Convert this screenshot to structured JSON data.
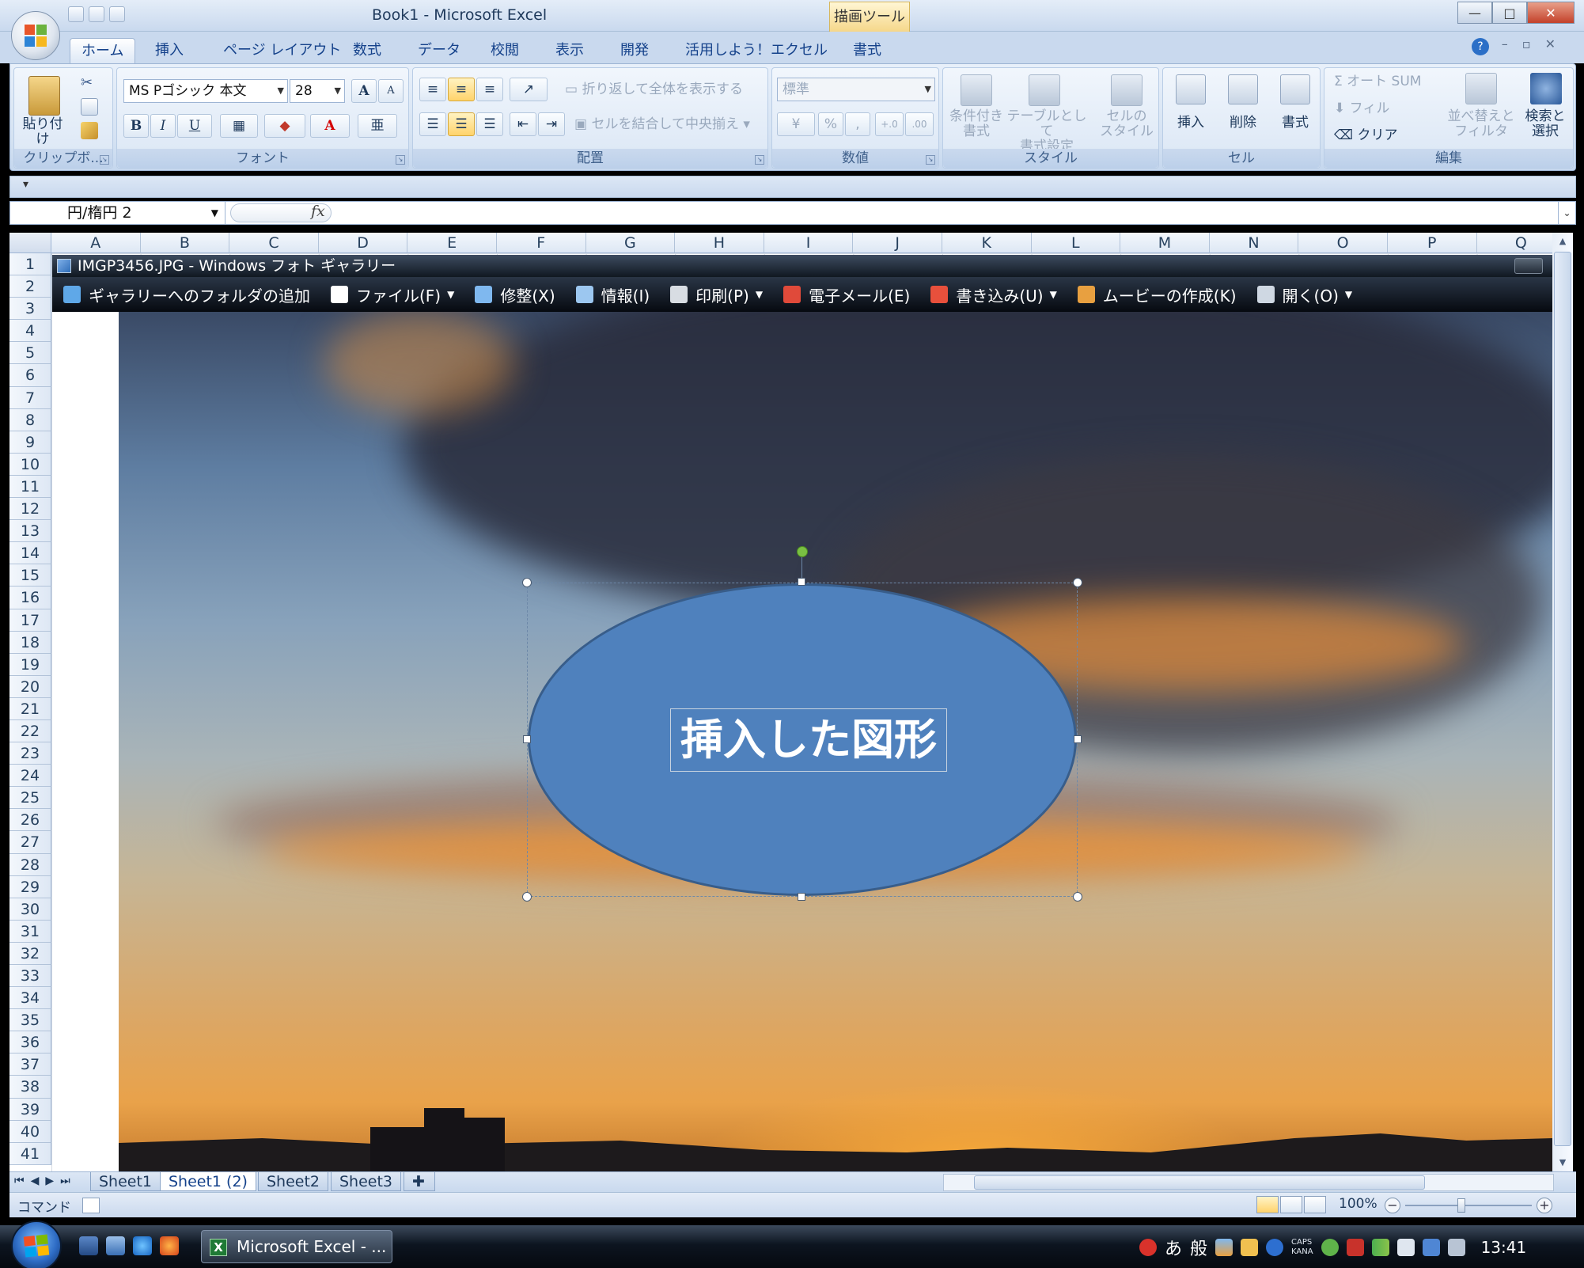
{
  "window": {
    "title": "Book1 - Microsoft Excel",
    "context_tab_title": "描画ツール",
    "controls": {
      "minimize": "—",
      "maximize": "□",
      "close": "✕"
    }
  },
  "ribbon": {
    "tabs": [
      "ホーム",
      "挿入",
      "ページ レイアウト",
      "数式",
      "データ",
      "校閲",
      "表示",
      "開発",
      "活用しよう！エクセル",
      "書式"
    ],
    "active_tab": "ホーム",
    "clipboard": {
      "paste": "貼り付け",
      "group_label": "クリップボ..."
    },
    "font": {
      "font_name": "MS Pゴシック 本文",
      "font_size": "28",
      "bold": "B",
      "italic": "I",
      "underline": "U",
      "grow": "A",
      "shrink": "A",
      "font_color_letter": "A",
      "group_label": "フォント"
    },
    "alignment": {
      "wrap_text": "折り返して全体を表示する",
      "merge_center": "セルを結合して中央揃え",
      "group_label": "配置"
    },
    "number": {
      "format": "標準",
      "percent": "%",
      "comma": ",",
      "inc_decimal": "+.0",
      "dec_decimal": ".00",
      "group_label": "数値"
    },
    "styles": {
      "conditional_l1": "条件付き",
      "conditional_l2": "書式",
      "table_l1": "テーブルとして",
      "table_l2": "書式設定",
      "cell_styles_l1": "セルの",
      "cell_styles_l2": "スタイル",
      "group_label": "スタイル"
    },
    "cells": {
      "insert": "挿入",
      "delete": "削除",
      "format": "書式",
      "group_label": "セル"
    },
    "editing": {
      "autosum": "Σ オート SUM",
      "fill": "フィル",
      "clear": "クリア",
      "sort_l1": "並べ替えと",
      "sort_l2": "フィルタ",
      "find_l1": "検索と",
      "find_l2": "選択",
      "group_label": "編集"
    }
  },
  "formula_bar": {
    "name_box": "円/楕円 2",
    "fx": "fx",
    "formula": ""
  },
  "grid": {
    "columns": [
      "A",
      "B",
      "C",
      "D",
      "E",
      "F",
      "G",
      "H",
      "I",
      "J",
      "K",
      "L",
      "M",
      "N",
      "O",
      "P",
      "Q"
    ],
    "rows": [
      "1",
      "2",
      "3",
      "4",
      "5",
      "6",
      "7",
      "8",
      "9",
      "10",
      "11",
      "12",
      "13",
      "14",
      "15",
      "16",
      "17",
      "18",
      "19",
      "20",
      "21",
      "22",
      "23",
      "24",
      "25",
      "26",
      "27",
      "28",
      "29",
      "30",
      "31",
      "32",
      "33",
      "34",
      "35",
      "36",
      "37",
      "38",
      "39",
      "40",
      "41"
    ]
  },
  "gallery": {
    "title": "IMGP3456.JPG - Windows フォト ギャラリー",
    "toolbar": [
      {
        "label": "ギャラリーへのフォルダの追加",
        "icon": "add-folder-icon",
        "color": "#5fa8e8",
        "dropdown": false
      },
      {
        "label": "ファイル(F)",
        "icon": "file-icon",
        "color": "#ffffff",
        "dropdown": true
      },
      {
        "label": "修整(X)",
        "icon": "fix-icon",
        "color": "#7fb8ef",
        "dropdown": false
      },
      {
        "label": "情報(I)",
        "icon": "info-tag-icon",
        "color": "#9cc7f0",
        "dropdown": false
      },
      {
        "label": "印刷(P)",
        "icon": "print-icon",
        "color": "#d8dde3",
        "dropdown": true
      },
      {
        "label": "電子メール(E)",
        "icon": "email-icon",
        "color": "#e04a3a",
        "dropdown": false
      },
      {
        "label": "書き込み(U)",
        "icon": "burn-disc-icon",
        "color": "#e8503c",
        "dropdown": true
      },
      {
        "label": "ムービーの作成(K)",
        "icon": "movie-icon",
        "color": "#e8a040",
        "dropdown": false
      },
      {
        "label": "開く(O)",
        "icon": "open-icon",
        "color": "#cfd8e3",
        "dropdown": true
      }
    ]
  },
  "shape": {
    "text": "挿入した図形",
    "fill": "#4f81bd",
    "outline": "#385d8a"
  },
  "sheets": {
    "tabs": [
      "Sheet1",
      "Sheet1 (2)",
      "Sheet2",
      "Sheet3"
    ],
    "active": "Sheet1 (2)",
    "nav": "⏮◀▶⏭"
  },
  "status": {
    "mode": "コマンド",
    "zoom": "100%",
    "minus": "−",
    "plus": "+"
  },
  "taskbar": {
    "excel_button": "Microsoft Excel - ...",
    "ime_mode": "あ",
    "ime_kanji": "般",
    "caps": "CAPS",
    "kana": "KANA",
    "clock": "13:41"
  }
}
